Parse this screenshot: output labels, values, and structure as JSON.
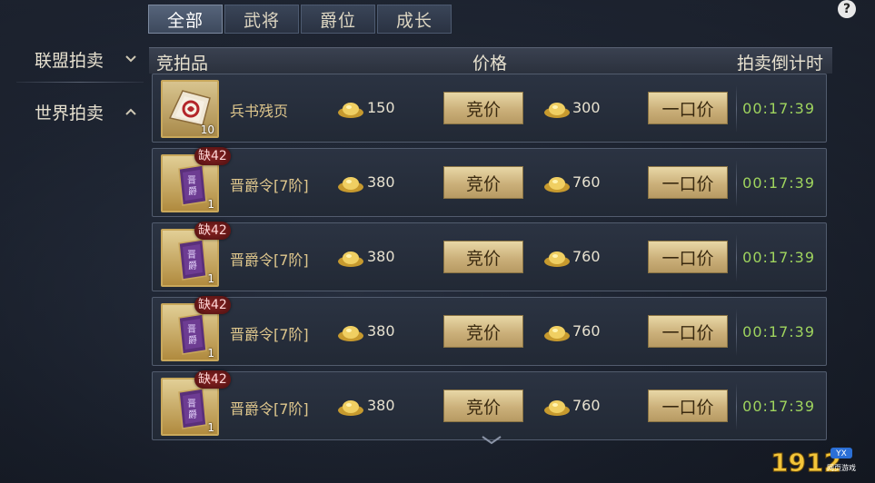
{
  "tabs": [
    {
      "label": "全部",
      "active": true
    },
    {
      "label": "武将",
      "active": false
    },
    {
      "label": "爵位",
      "active": false
    },
    {
      "label": "成长",
      "active": false
    }
  ],
  "help": "?",
  "sidebar": {
    "items": [
      {
        "label": "联盟拍卖",
        "chevron": "chevron-down-icon"
      },
      {
        "label": "世界拍卖",
        "chevron": "chevron-up-icon"
      }
    ]
  },
  "header": {
    "item": "竞拍品",
    "price": "价格",
    "timer": "拍卖倒计时"
  },
  "rows": [
    {
      "name": "兵书残页",
      "count": "10",
      "shortage": "",
      "bid_price": "150",
      "buyout_price": "300",
      "bid_label": "竞价",
      "buyout_label": "一口价",
      "timer": "00:17:39",
      "icon": "book-fragment-icon"
    },
    {
      "name": "晋爵令[7阶]",
      "count": "1",
      "shortage": "缺42",
      "bid_price": "380",
      "buyout_price": "760",
      "bid_label": "竞价",
      "buyout_label": "一口价",
      "timer": "00:17:39",
      "icon": "promotion-token-icon"
    },
    {
      "name": "晋爵令[7阶]",
      "count": "1",
      "shortage": "缺42",
      "bid_price": "380",
      "buyout_price": "760",
      "bid_label": "竞价",
      "buyout_label": "一口价",
      "timer": "00:17:39",
      "icon": "promotion-token-icon"
    },
    {
      "name": "晋爵令[7阶]",
      "count": "1",
      "shortage": "缺42",
      "bid_price": "380",
      "buyout_price": "760",
      "bid_label": "竞价",
      "buyout_label": "一口价",
      "timer": "00:17:39",
      "icon": "promotion-token-icon"
    },
    {
      "name": "晋爵令[7阶]",
      "count": "1",
      "shortage": "缺42",
      "bid_price": "380",
      "buyout_price": "760",
      "bid_label": "竞价",
      "buyout_label": "一口价",
      "timer": "00:17:39",
      "icon": "promotion-token-icon"
    }
  ],
  "watermark": {
    "text": "1912",
    "badge": "YX",
    "sub": "网页游戏"
  },
  "colors": {
    "timer": "#9fd45e",
    "gold": "#dfc78d",
    "button": "#cbb07a"
  }
}
